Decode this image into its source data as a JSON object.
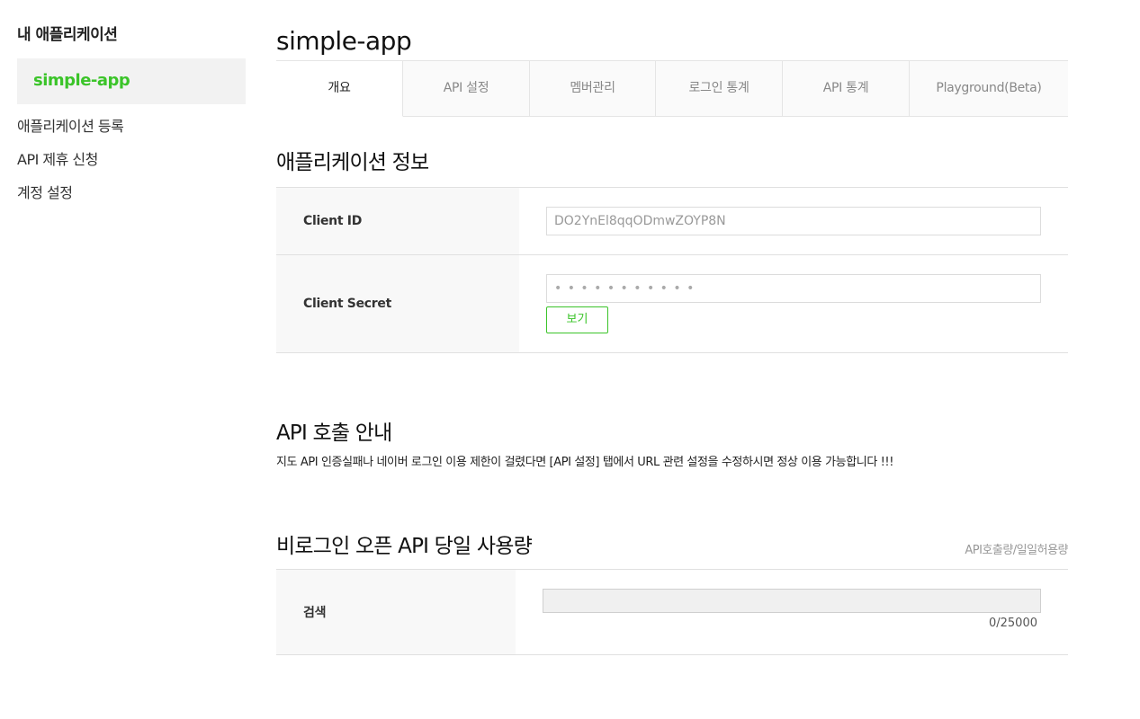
{
  "sidebar": {
    "title": "내 애플리케이션",
    "selected_app": "simple-app",
    "links": [
      "애플리케이션 등록",
      "API 제휴 신청",
      "계정 설정"
    ]
  },
  "main": {
    "app_title": "simple-app",
    "tabs": [
      {
        "label": "개요",
        "active": true
      },
      {
        "label": "API 설정",
        "active": false
      },
      {
        "label": "멤버관리",
        "active": false
      },
      {
        "label": "로그인 통계",
        "active": false
      },
      {
        "label": "API 통계",
        "active": false
      },
      {
        "label": "Playground(Beta)",
        "active": false
      }
    ]
  },
  "app_info": {
    "heading": "애플리케이션 정보",
    "client_id_label": "Client ID",
    "client_id_value": "DO2YnEl8qqODmwZOYP8N",
    "client_secret_label": "Client Secret",
    "client_secret_value": "• • • • • • • • • • •",
    "view_button": "보기"
  },
  "api_notice": {
    "heading": "API 호출 안내",
    "text": "지도 API 인증실패나 네이버 로그인 이용 제한이 걸렸다면 [API 설정] 탭에서 URL 관련 설정을 수정하시면 정상 이용 가능합니다 !!!"
  },
  "usage": {
    "heading": "비로그인 오픈 API 당일 사용량",
    "note": "API호출량/일일허용량",
    "rows": [
      {
        "label": "검색",
        "used": 0,
        "limit": 25000,
        "count_text": "0/25000"
      }
    ]
  },
  "colors": {
    "accent": "#3bc429"
  }
}
